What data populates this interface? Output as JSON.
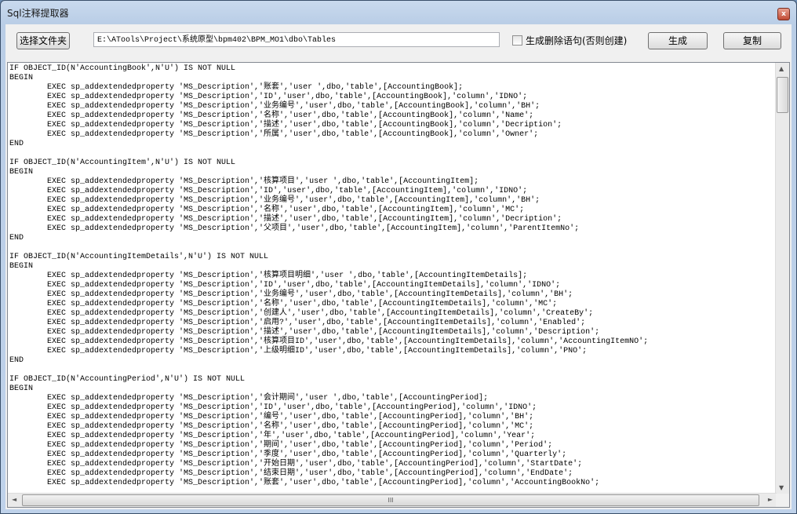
{
  "window": {
    "title": "Sql注释提取器",
    "close_label": "x"
  },
  "toolbar": {
    "select_folder_label": "选择文件夹",
    "path_value": "E:\\ATools\\Project\\系统原型\\bpm402\\BPM_MO1\\dbo\\Tables",
    "drop_checkbox_label": "生成删除语句(否则创建)",
    "drop_checked": false,
    "generate_label": "生成",
    "copy_label": "复制"
  },
  "scrollbar": {
    "grip": "III",
    "left_arrow": "◄",
    "up_arrow": "▲",
    "down_arrow": "▼",
    "right_arrow": "►"
  },
  "code_lines": [
    "IF OBJECT_ID(N'AccountingBook',N'U') IS NOT NULL",
    "BEGIN",
    "\tEXEC sp_addextendedproperty 'MS_Description','账套','user ',dbo,'table',[AccountingBook];",
    "\tEXEC sp_addextendedproperty 'MS_Description','ID','user',dbo,'table',[AccountingBook],'column','IDNO';",
    "\tEXEC sp_addextendedproperty 'MS_Description','业务编号','user',dbo,'table',[AccountingBook],'column','BH';",
    "\tEXEC sp_addextendedproperty 'MS_Description','名称','user',dbo,'table',[AccountingBook],'column','Name';",
    "\tEXEC sp_addextendedproperty 'MS_Description','描述','user',dbo,'table',[AccountingBook],'column','Decription';",
    "\tEXEC sp_addextendedproperty 'MS_Description','所属','user',dbo,'table',[AccountingBook],'column','Owner';",
    "END",
    "",
    "IF OBJECT_ID(N'AccountingItem',N'U') IS NOT NULL",
    "BEGIN",
    "\tEXEC sp_addextendedproperty 'MS_Description','核算项目','user ',dbo,'table',[AccountingItem];",
    "\tEXEC sp_addextendedproperty 'MS_Description','ID','user',dbo,'table',[AccountingItem],'column','IDNO';",
    "\tEXEC sp_addextendedproperty 'MS_Description','业务编号','user',dbo,'table',[AccountingItem],'column','BH';",
    "\tEXEC sp_addextendedproperty 'MS_Description','名称','user',dbo,'table',[AccountingItem],'column','MC';",
    "\tEXEC sp_addextendedproperty 'MS_Description','描述','user',dbo,'table',[AccountingItem],'column','Decription';",
    "\tEXEC sp_addextendedproperty 'MS_Description','父项目','user',dbo,'table',[AccountingItem],'column','ParentItemNo';",
    "END",
    "",
    "IF OBJECT_ID(N'AccountingItemDetails',N'U') IS NOT NULL",
    "BEGIN",
    "\tEXEC sp_addextendedproperty 'MS_Description','核算项目明细','user ',dbo,'table',[AccountingItemDetails];",
    "\tEXEC sp_addextendedproperty 'MS_Description','ID','user',dbo,'table',[AccountingItemDetails],'column','IDNO';",
    "\tEXEC sp_addextendedproperty 'MS_Description','业务编号','user',dbo,'table',[AccountingItemDetails],'column','BH';",
    "\tEXEC sp_addextendedproperty 'MS_Description','名称','user',dbo,'table',[AccountingItemDetails],'column','MC';",
    "\tEXEC sp_addextendedproperty 'MS_Description','创建人','user',dbo,'table',[AccountingItemDetails],'column','CreateBy';",
    "\tEXEC sp_addextendedproperty 'MS_Description','启用?','user',dbo,'table',[AccountingItemDetails],'column','Enabled';",
    "\tEXEC sp_addextendedproperty 'MS_Description','描述','user',dbo,'table',[AccountingItemDetails],'column','Description';",
    "\tEXEC sp_addextendedproperty 'MS_Description','核算项目ID','user',dbo,'table',[AccountingItemDetails],'column','AccountingItemNO';",
    "\tEXEC sp_addextendedproperty 'MS_Description','上级明细ID','user',dbo,'table',[AccountingItemDetails],'column','PNO';",
    "END",
    "",
    "IF OBJECT_ID(N'AccountingPeriod',N'U') IS NOT NULL",
    "BEGIN",
    "\tEXEC sp_addextendedproperty 'MS_Description','会计期间','user ',dbo,'table',[AccountingPeriod];",
    "\tEXEC sp_addextendedproperty 'MS_Description','ID','user',dbo,'table',[AccountingPeriod],'column','IDNO';",
    "\tEXEC sp_addextendedproperty 'MS_Description','编号','user',dbo,'table',[AccountingPeriod],'column','BH';",
    "\tEXEC sp_addextendedproperty 'MS_Description','名称','user',dbo,'table',[AccountingPeriod],'column','MC';",
    "\tEXEC sp_addextendedproperty 'MS_Description','年','user',dbo,'table',[AccountingPeriod],'column','Year';",
    "\tEXEC sp_addextendedproperty 'MS_Description','期间','user',dbo,'table',[AccountingPeriod],'column','Period';",
    "\tEXEC sp_addextendedproperty 'MS_Description','季度','user',dbo,'table',[AccountingPeriod],'column','Quarterly';",
    "\tEXEC sp_addextendedproperty 'MS_Description','开始日期','user',dbo,'table',[AccountingPeriod],'column','StartDate';",
    "\tEXEC sp_addextendedproperty 'MS_Description','结束日期','user',dbo,'table',[AccountingPeriod],'column','EndDate';",
    "\tEXEC sp_addextendedproperty 'MS_Description','账套','user',dbo,'table',[AccountingPeriod],'column','AccountingBookNo';"
  ]
}
